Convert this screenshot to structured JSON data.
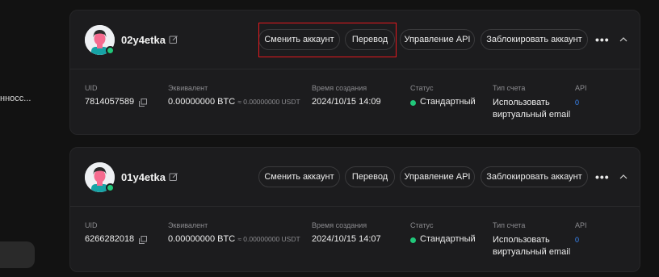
{
  "sidebar": {
    "truncated_text": "нносс..."
  },
  "fields": {
    "uid_label": "UID",
    "equiv_label": "Эквивалент",
    "created_label": "Время создания",
    "status_label": "Статус",
    "type_label": "Тип счета",
    "api_label": "API"
  },
  "accounts": [
    {
      "name": "02y4etka",
      "buttons": [
        "Сменить аккаунт",
        "Перевод",
        "Управление API",
        "Заблокировать аккаунт"
      ],
      "uid": "7814057589",
      "equiv_btc": "0.00000000 BTC",
      "equiv_usdt": "≈ 0.00000000 USDT",
      "created": "2024/10/15 14:09",
      "status": "Стандартный",
      "account_type": "Использовать виртуальный email",
      "api": "0"
    },
    {
      "name": "01y4etka",
      "buttons": [
        "Сменить аккаунт",
        "Перевод",
        "Управление API",
        "Заблокировать аккаунт"
      ],
      "uid": "6266282018",
      "equiv_btc": "0.00000000 BTC",
      "equiv_usdt": "≈ 0.00000000 USDT",
      "created": "2024/10/15 14:07",
      "status": "Стандартный",
      "account_type": "Использовать виртуальный email",
      "api": "0"
    }
  ],
  "icons": {
    "edit": "edit-icon",
    "copy": "copy-icon",
    "more": "more-icon",
    "collapse": "chevron-up-icon"
  },
  "colors": {
    "online": "#21c77a",
    "api_link": "#3b8cff",
    "highlight": "#e5181e"
  }
}
